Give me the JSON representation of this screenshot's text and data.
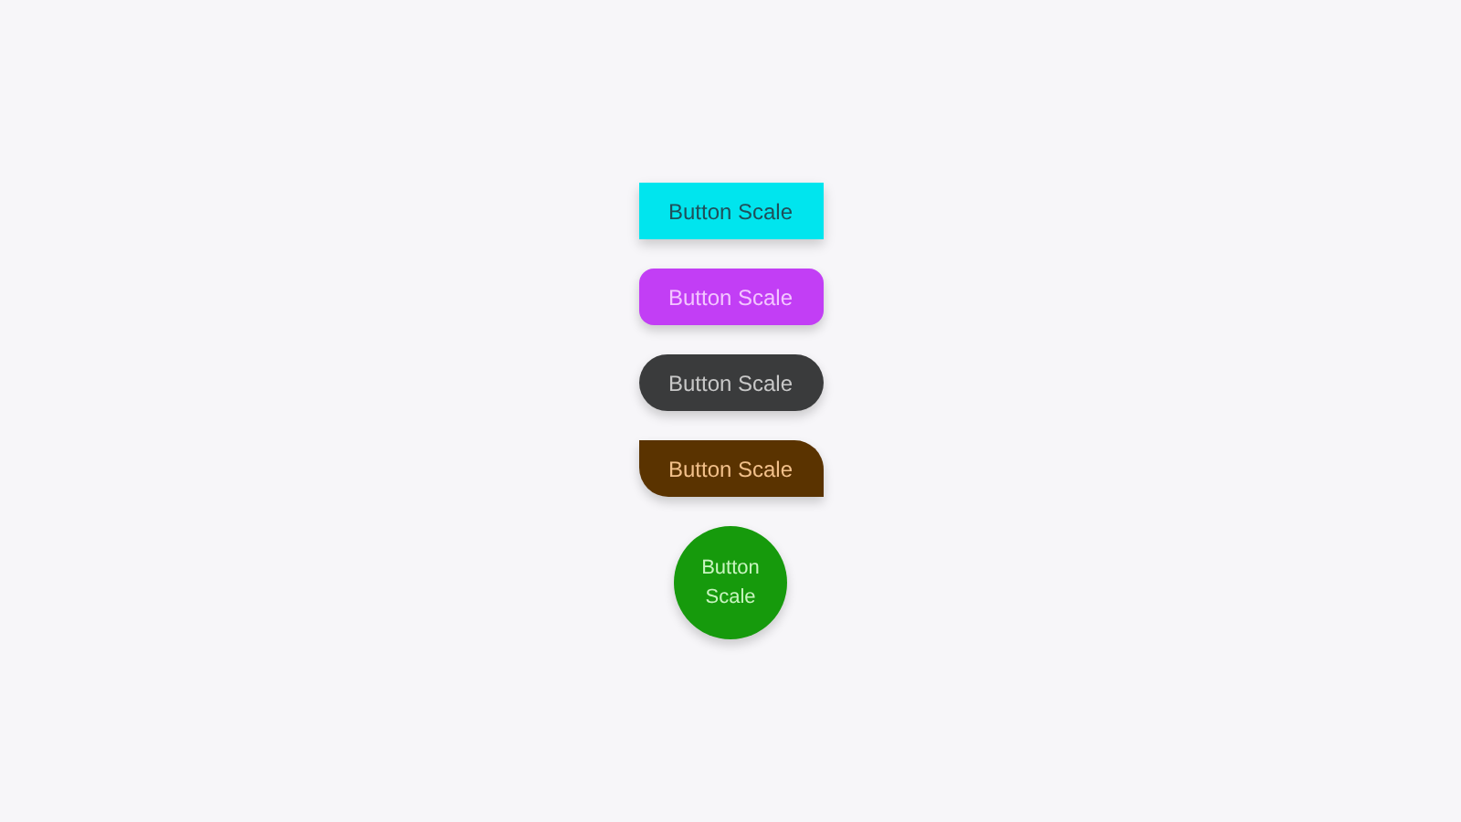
{
  "buttons": [
    {
      "kind": "square",
      "label": "Button Scale"
    },
    {
      "kind": "rounded",
      "label": "Button Scale"
    },
    {
      "kind": "pill",
      "label": "Button Scale"
    },
    {
      "kind": "leaf",
      "label": "Button Scale"
    },
    {
      "kind": "circle",
      "label": "Button Scale"
    }
  ]
}
